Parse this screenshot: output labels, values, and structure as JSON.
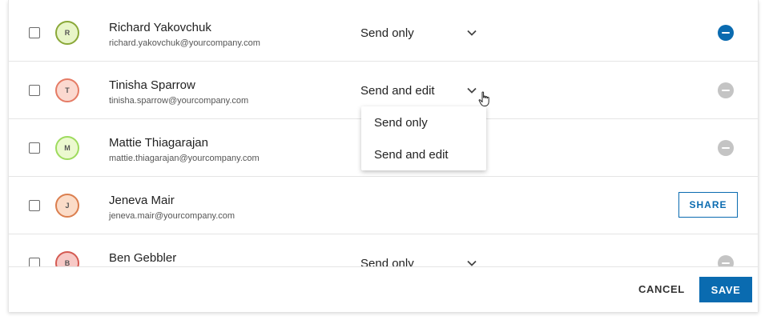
{
  "rows": [
    {
      "initial": "R",
      "name": "Richard Yakovchuk",
      "email": "richard.yakovchuk@yourcompany.com",
      "permission": "Send only",
      "avatar_bg": "#e8f5c8",
      "avatar_border": "#8aa838"
    },
    {
      "initial": "T",
      "name": "Tinisha Sparrow",
      "email": "tinisha.sparrow@yourcompany.com",
      "permission": "Send and edit",
      "avatar_bg": "#fbd9d0",
      "avatar_border": "#e57b65"
    },
    {
      "initial": "M",
      "name": "Mattie Thiagarajan",
      "email": "mattie.thiagarajan@yourcompany.com",
      "permission": "",
      "avatar_bg": "#ecf9d0",
      "avatar_border": "#9edb5e"
    },
    {
      "initial": "J",
      "name": "Jeneva Mair",
      "email": "jeneva.mair@yourcompany.com",
      "permission": "",
      "avatar_bg": "#fbdcc8",
      "avatar_border": "#db7f4f"
    },
    {
      "initial": "B",
      "name": "Ben Gebbler",
      "email": "",
      "permission": "Send only",
      "avatar_bg": "#f7c9c6",
      "avatar_border": "#d45a52"
    }
  ],
  "dropdown": {
    "options": [
      "Send only",
      "Send and edit"
    ]
  },
  "share_label": "SHARE",
  "footer": {
    "cancel_label": "CANCEL",
    "save_label": "SAVE"
  },
  "colors": {
    "accent": "#0a6bb0",
    "remove_active": "#0a6bb0",
    "remove_inactive": "#c4c4c4"
  }
}
